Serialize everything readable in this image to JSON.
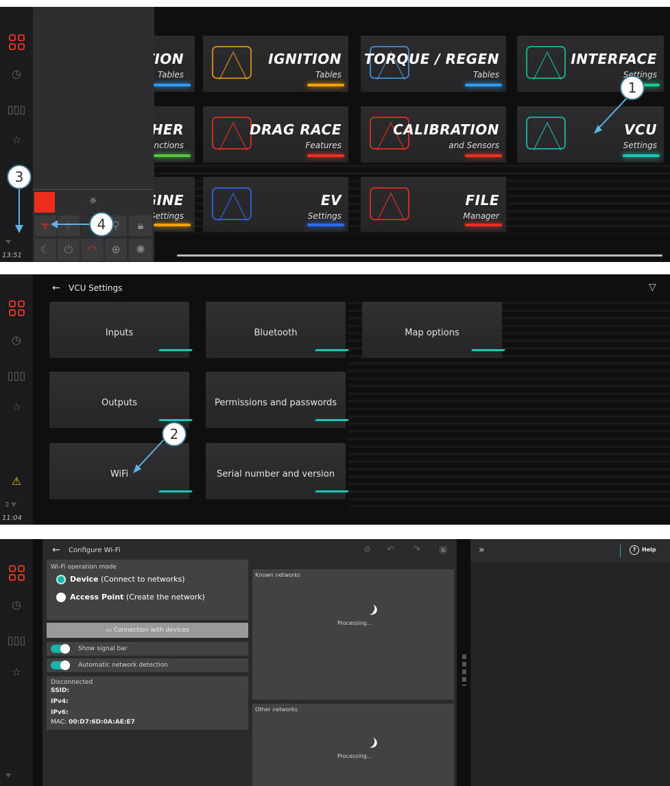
{
  "shot1": {
    "time": "13:51",
    "tiles": [
      {
        "title": "TION",
        "sub": "Tables",
        "bar": "#2f9cf0"
      },
      {
        "title": "IGNITION",
        "sub": "Tables",
        "bar": "#f5a20a"
      },
      {
        "title": "TORQUE / REGEN",
        "sub": "Tables",
        "bar": "#2f9cf0"
      },
      {
        "title": "INTERFACE",
        "sub": "Settings",
        "bar": "#1dc98f"
      },
      {
        "title": "THER",
        "sub": "unctions",
        "bar": "#58c840"
      },
      {
        "title": "DRAG RACE",
        "sub": "Features",
        "bar": "#f03020"
      },
      {
        "title": "CALIBRATION",
        "sub": "and Sensors",
        "bar": "#f03020"
      },
      {
        "title": "VCU",
        "sub": "Settings",
        "bar": "#18c9b8"
      },
      {
        "title": "GINE",
        "sub": "Settings",
        "bar": "#f5a20a"
      },
      {
        "title": "EV",
        "sub": "Settings",
        "bar": "#2f6cf0"
      },
      {
        "title": "FILE",
        "sub": "Manager",
        "bar": "#f03020"
      }
    ],
    "callouts": [
      "1",
      "3",
      "4"
    ]
  },
  "shot2": {
    "title": "VCU Settings",
    "time": "11:04",
    "tiles": [
      "Inputs",
      "Bluetooth",
      "Map options",
      "Outputs",
      "Permissions and passwords",
      "WiFi",
      "Serial number and version"
    ],
    "callout": "2"
  },
  "shot3": {
    "title": "Configure Wi-Fi",
    "help": "Help",
    "mode_label": "Wi-Fi operation mode",
    "device_bold": "Device",
    "device_rest": "(Connect to networks)",
    "ap_bold": "Access Point",
    "ap_rest": "(Create the network)",
    "conn_button": "Connection with devices",
    "show_signal": "Show signal bar",
    "auto_detect": "Automatic network detection",
    "status": "Disconnected",
    "ssid": "SSID:",
    "ipv4": "IPv4:",
    "ipv6": "IPv6:",
    "mac_label": "MAC:",
    "mac_value": "00:D7:6D:0A:AE:E7",
    "known": "Known networks",
    "other": "Other networks",
    "processing": "Processing..."
  }
}
